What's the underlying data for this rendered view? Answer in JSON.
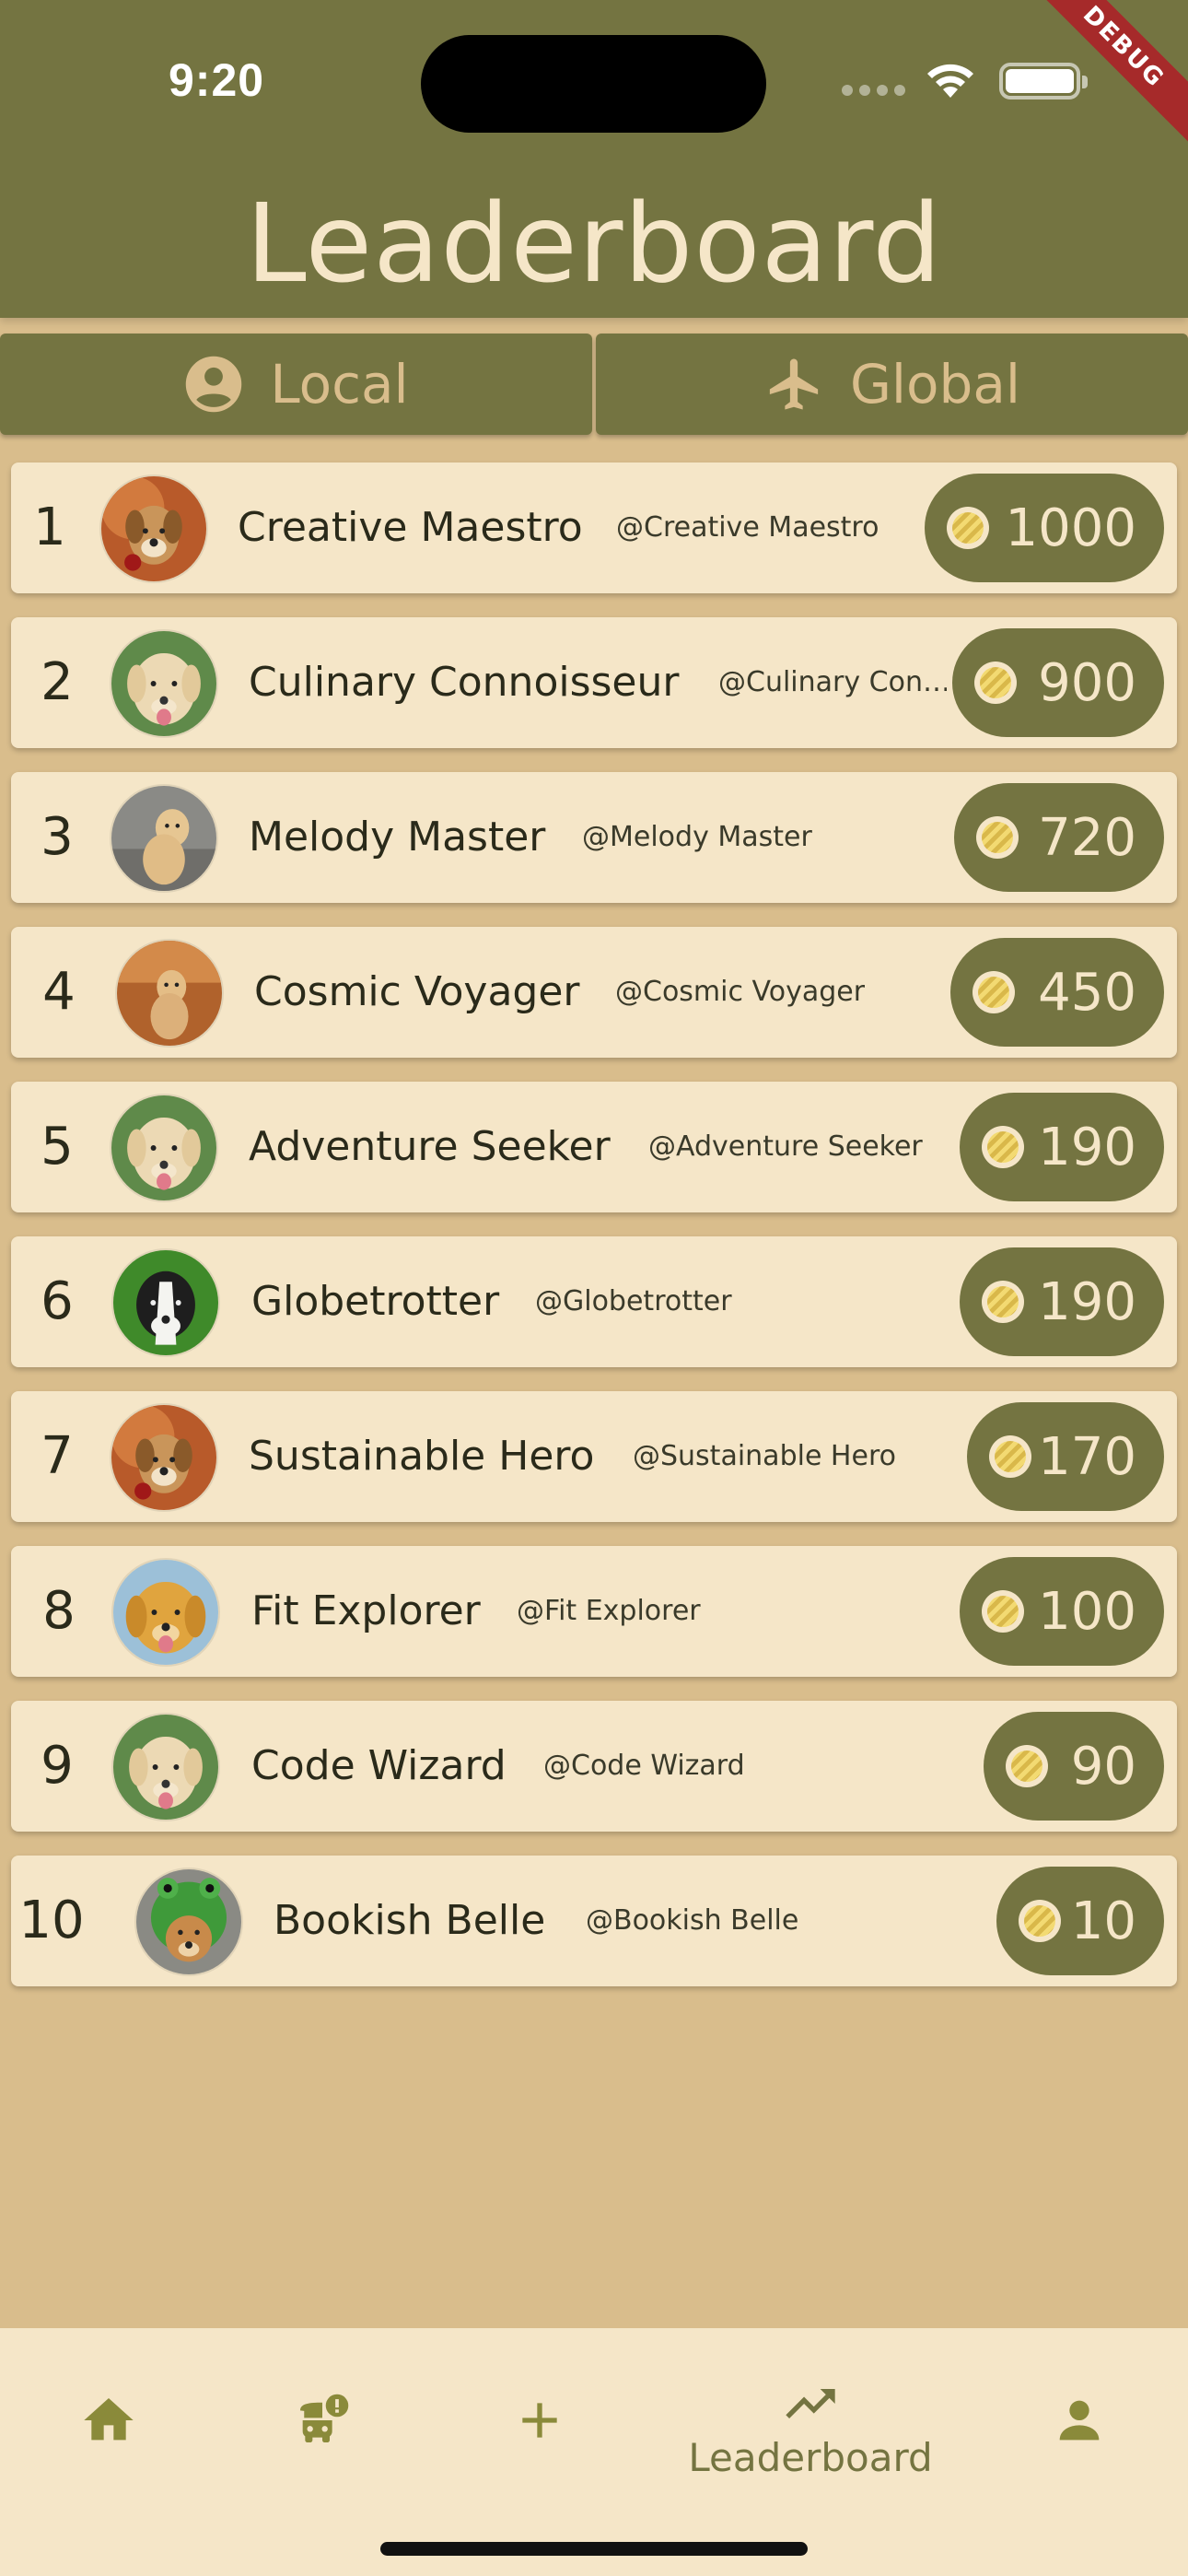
{
  "status_bar": {
    "time": "9:20"
  },
  "debug_banner": "DEBUG",
  "header": {
    "title": "Leaderboard"
  },
  "tabs": [
    {
      "label": "Local",
      "icon": "account-circle-icon"
    },
    {
      "label": "Global",
      "icon": "airplane-icon"
    }
  ],
  "leaderboard": [
    {
      "rank": "1",
      "name": "Creative Maestro",
      "handle": "@Creative Maestro",
      "points": "1000"
    },
    {
      "rank": "2",
      "name": "Culinary Connoisseur",
      "handle": "@Culinary Con…",
      "points": "900"
    },
    {
      "rank": "3",
      "name": "Melody Master",
      "handle": "@Melody Master",
      "points": "720"
    },
    {
      "rank": "4",
      "name": "Cosmic Voyager",
      "handle": "@Cosmic Voyager",
      "points": "450"
    },
    {
      "rank": "5",
      "name": "Adventure Seeker",
      "handle": "@Adventure Seeker",
      "points": "190"
    },
    {
      "rank": "6",
      "name": "Globetrotter",
      "handle": "@Globetrotter",
      "points": "190"
    },
    {
      "rank": "7",
      "name": "Sustainable Hero",
      "handle": "@Sustainable Hero",
      "points": "170"
    },
    {
      "rank": "8",
      "name": "Fit Explorer",
      "handle": "@Fit Explorer",
      "points": "100"
    },
    {
      "rank": "9",
      "name": "Code Wizard",
      "handle": "@Code Wizard",
      "points": "90"
    },
    {
      "rank": "10",
      "name": "Bookish Belle",
      "handle": "@Bookish Belle",
      "points": "10"
    }
  ],
  "bottom_nav": {
    "items": [
      {
        "icon": "home-icon"
      },
      {
        "icon": "bus-alert-icon"
      },
      {
        "icon": "add-icon"
      },
      {
        "icon": "trending-up-icon",
        "label": "Leaderboard"
      },
      {
        "icon": "person-icon"
      }
    ]
  },
  "colors": {
    "header": "#747441",
    "background": "#d9bd8c",
    "card": "#f5e6c8",
    "pill": "#747441",
    "tab_text": "#d9bd8c"
  }
}
